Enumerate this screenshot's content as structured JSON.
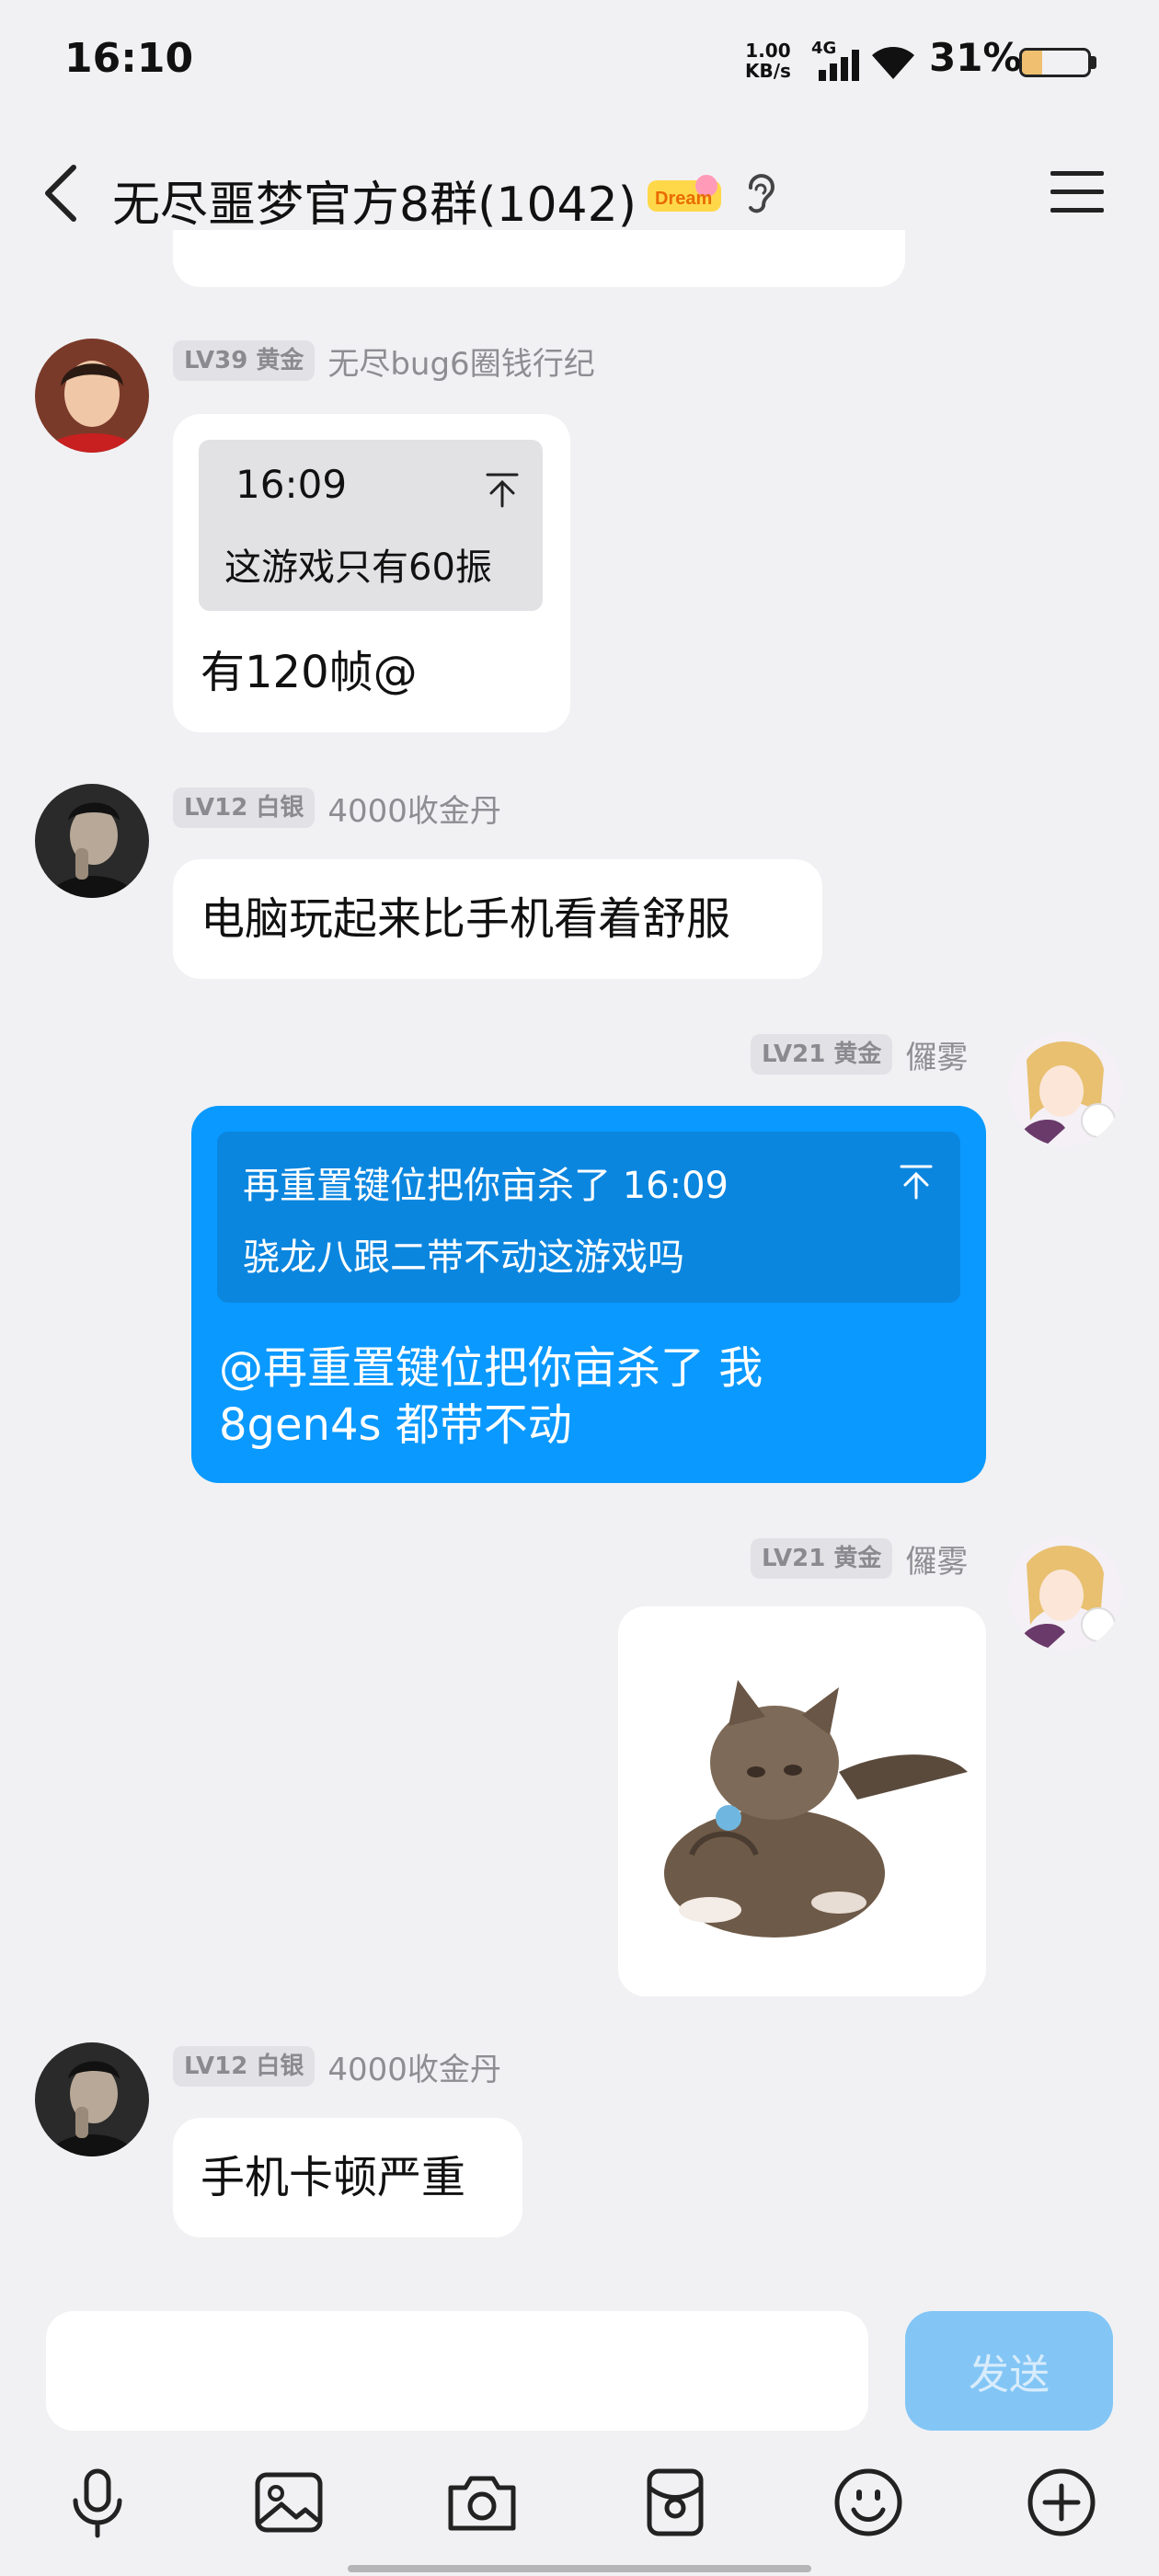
{
  "status_bar": {
    "time": "16:10",
    "net_speed_value": "1.00",
    "net_speed_unit": "KB/s",
    "network_type": "4G",
    "battery_percent": "31%",
    "battery_level": 0.31
  },
  "header": {
    "title": "无尽噩梦官方8群(1042)",
    "game_badge_icon": "game-logo-icon",
    "ear_icon": "ear-icon",
    "menu_icon": "hamburger-menu-icon"
  },
  "messages": [
    {
      "level": "LV39 黄金",
      "nickname": "无尽bug6圈钱行纪",
      "quote_time": "16:09",
      "quote_text": "这游戏只有60振",
      "text": "有120帧@"
    },
    {
      "level": "LV12 白银",
      "nickname": "4000收金丹",
      "text": "电脑玩起来比手机看着舒服"
    },
    {
      "level": "LV21 黄金",
      "nickname": "儸雾",
      "quote_head": "再重置键位把你亩杀了 16:09",
      "quote_text": "骁龙八跟二带不动这游戏吗",
      "text_line1": "@再重置键位把你亩杀了 我",
      "text_line2": "8gen4s 都带不动"
    },
    {
      "level": "LV21 黄金",
      "nickname": "儸雾",
      "image": "kitten-sticker"
    },
    {
      "level": "LV12 白银",
      "nickname": "4000收金丹",
      "text": "手机卡顿严重"
    }
  ],
  "input": {
    "placeholder": "",
    "send_label": "发送"
  },
  "colors": {
    "accent": "#0a99ff",
    "background": "#f1f1f3",
    "send_disabled": "#83c6f6"
  }
}
